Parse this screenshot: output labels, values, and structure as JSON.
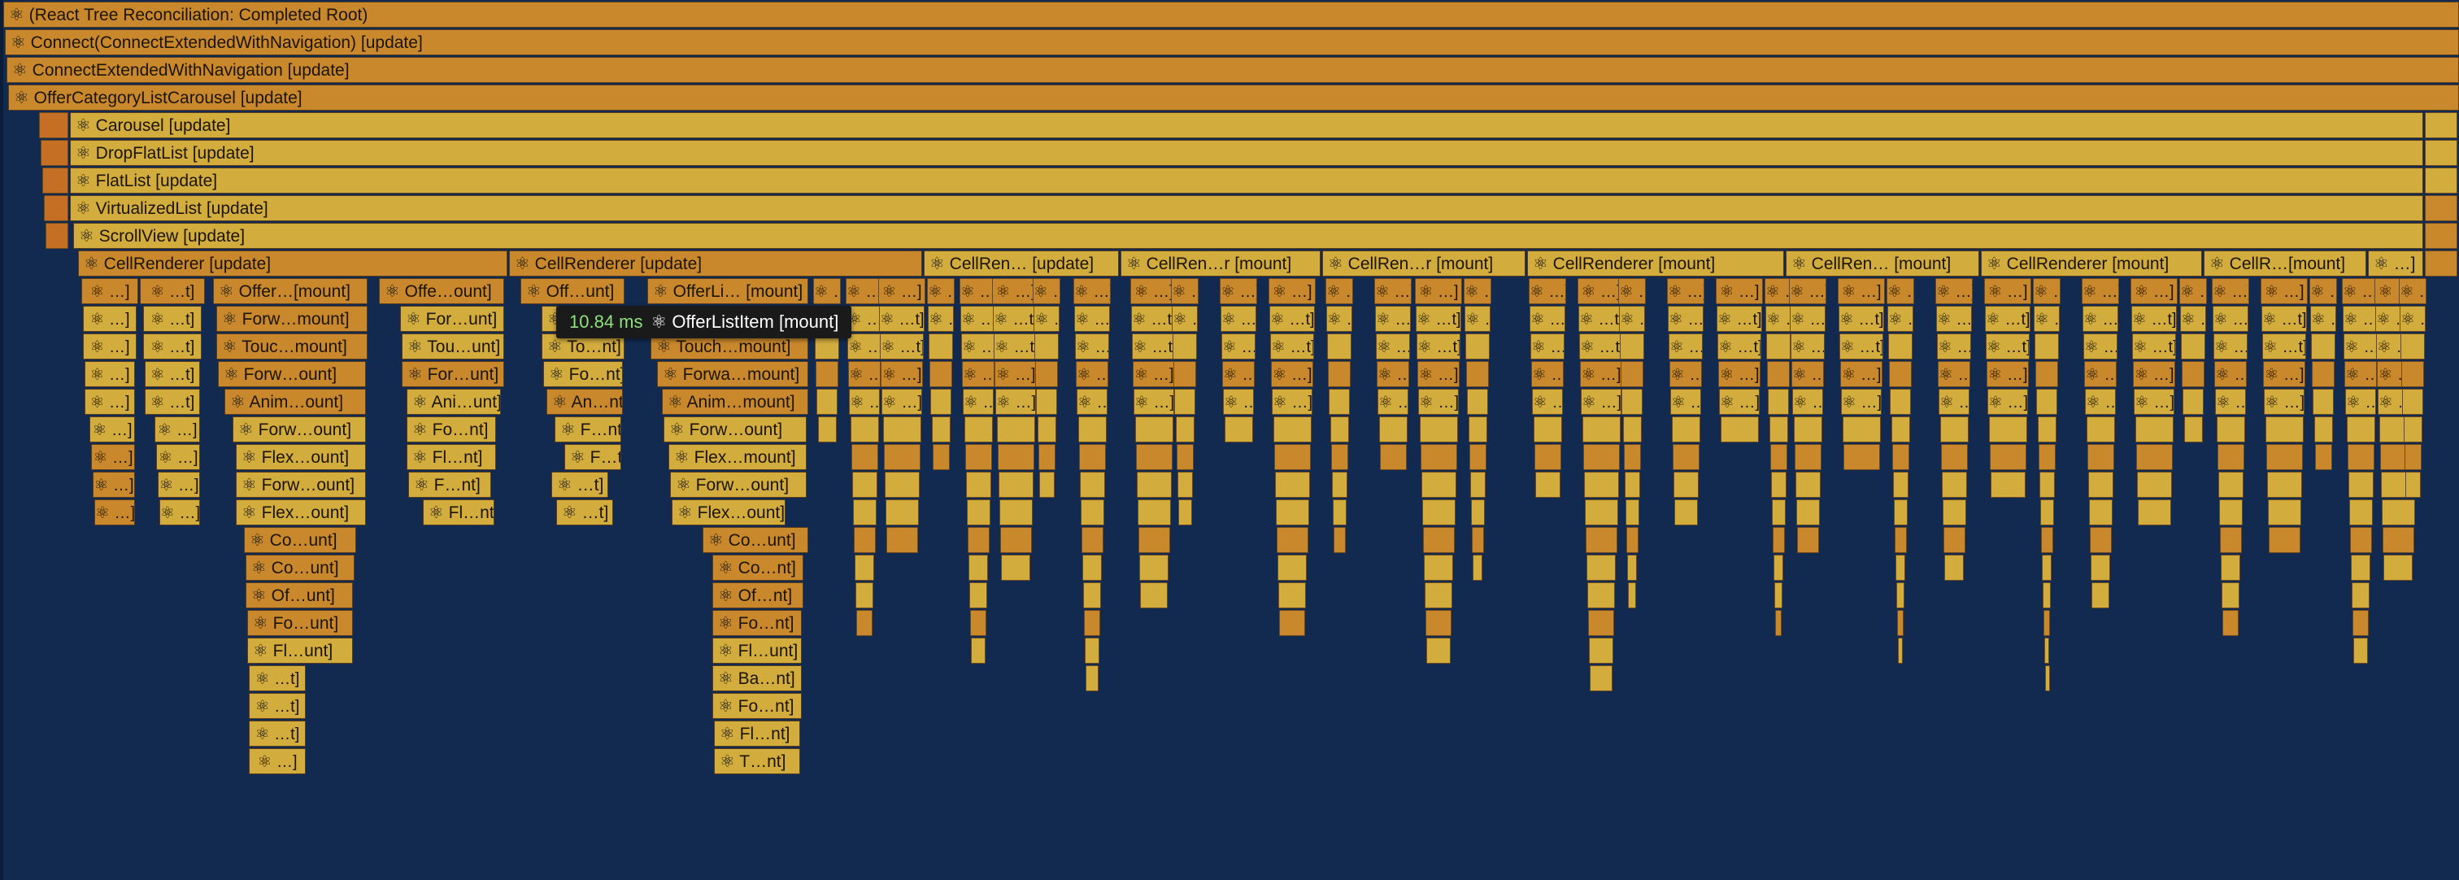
{
  "colors": {
    "background": "#122a50",
    "tooltip_bg": "#1a1a1a",
    "duration_text": "#8ee37d"
  },
  "rows": [
    {
      "label": "⚛ (React Tree Reconciliation: Completed Root)"
    },
    {
      "label": "⚛ Connect(ConnectExtendedWithNavigation) [update]"
    },
    {
      "label": "⚛ ConnectExtendedWithNavigation [update]"
    },
    {
      "label": "⚛ OfferCategoryListCarousel [update]"
    },
    {
      "label": "⚛ Carousel [update]"
    },
    {
      "label": "⚛ DropFlatList [update]"
    },
    {
      "label": "⚛ FlatList [update]"
    },
    {
      "label": "⚛ VirtualizedList [update]"
    },
    {
      "label": "⚛ ScrollView [update]"
    }
  ],
  "cell_renderers": [
    {
      "label": "⚛ CellRenderer [update]"
    },
    {
      "label": "⚛ CellRenderer [update]"
    },
    {
      "label": "⚛ CellRen… [update]"
    },
    {
      "label": "⚛ CellRen…r [mount]"
    },
    {
      "label": "⚛ CellRen…r [mount]"
    },
    {
      "label": "⚛ CellRenderer [mount]"
    },
    {
      "label": "⚛ CellRen… [mount]"
    },
    {
      "label": "⚛ CellRenderer [mount]"
    },
    {
      "label": "⚛ CellR…[mount]"
    },
    {
      "label": "⚛ …]"
    }
  ],
  "children": [
    {
      "labels": [
        "⚛ …]",
        "⚛ …]",
        "⚛ …]",
        "⚛ …]",
        "⚛ …]",
        "⚛ …]",
        "⚛ …]",
        "⚛ …]",
        "⚛ …]"
      ]
    },
    {
      "labels": [
        "⚛ …t]",
        "⚛ …t]",
        "⚛ …t]",
        "⚛ …t]",
        "⚛ …t]",
        "⚛ …]",
        "⚛ …]",
        "⚛ …]",
        "⚛ …]"
      ]
    },
    {
      "labels": [
        "⚛ Offer…[mount]",
        "⚛ Forw…mount]",
        "⚛ Touc…mount]",
        "⚛ Forw…ount]",
        "⚛ Anim…ount]",
        "⚛ Forw…ount]",
        "⚛ Flex…ount]",
        "⚛ Forw…ount]",
        "⚛ Flex…ount]",
        "⚛ Co…unt]",
        "⚛ Co…unt]",
        "⚛ Of…unt]",
        "⚛ Fo…unt]",
        "⚛ Fl…unt]",
        "⚛ …t]",
        "⚛ …t]",
        "⚛ …t]",
        "⚛ …]"
      ]
    },
    {
      "labels": [
        "⚛ Offe…ount]",
        "⚛ For…unt]",
        "⚛ Tou…unt]",
        "⚛ For…unt]",
        "⚛ Ani…unt]",
        "⚛ Fo…nt]",
        "⚛ Fl…nt]",
        "⚛ F…nt]",
        "⚛ Fl…nt]"
      ]
    },
    {
      "labels": [
        "⚛ Off…unt]",
        "⚛ F",
        "⚛ To…nt]",
        "⚛ Fo…nt]",
        "⚛ An…nt]",
        "⚛ F…nt]",
        "⚛ F…t]",
        "⚛ …t]",
        "⚛ …t]"
      ]
    },
    {
      "labels": [
        "⚛ OfferLi… [mount]",
        "",
        "⚛ Touch…mount]",
        "⚛ Forwa…mount]",
        "⚛ Anim…mount]",
        "⚛ Forw…ount]",
        "⚛ Flex…mount]",
        "⚛ Forw…ount]",
        "⚛ Flex…ount]",
        "⚛ Co…unt]",
        "⚛ Co…nt]",
        "⚛ Of…nt]",
        "⚛ Fo…nt]",
        "⚛ Fl…unt]",
        "⚛ Ba…nt]",
        "⚛ Fo…nt]",
        "⚛ Fl…nt]",
        "⚛ T…nt]"
      ]
    }
  ],
  "tooltip": {
    "duration": "10.84 ms",
    "label": "⚛ OfferListItem [mount]"
  },
  "mini_labels": [
    "⚛ …]",
    "⚛ …t]",
    "⚛ …t]",
    "⚛ …]",
    "⚛ …]"
  ]
}
